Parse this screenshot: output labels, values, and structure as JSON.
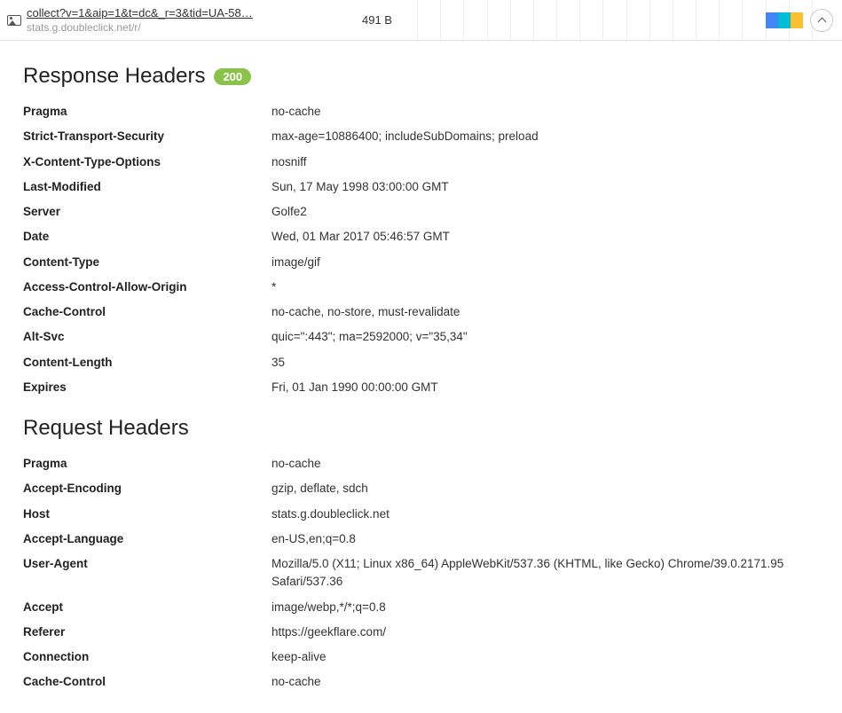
{
  "request_row": {
    "url_main": "collect?v=1&aip=1&t=dc&_r=3&tid=UA-58…",
    "url_sub": "stats.g.doubleclick.net/r/",
    "size": "491 B"
  },
  "swatch_colors": [
    "#4285f4",
    "#00bcd4",
    "#fbc02d"
  ],
  "response_section_title": "Response Headers",
  "status_badge": "200",
  "response_headers": [
    {
      "name": "Pragma",
      "value": "no-cache"
    },
    {
      "name": "Strict-Transport-Security",
      "value": "max-age=10886400; includeSubDomains; preload"
    },
    {
      "name": "X-Content-Type-Options",
      "value": "nosniff"
    },
    {
      "name": "Last-Modified",
      "value": "Sun, 17 May 1998 03:00:00 GMT"
    },
    {
      "name": "Server",
      "value": "Golfe2"
    },
    {
      "name": "Date",
      "value": "Wed, 01 Mar 2017 05:46:57 GMT"
    },
    {
      "name": "Content-Type",
      "value": "image/gif"
    },
    {
      "name": "Access-Control-Allow-Origin",
      "value": "*"
    },
    {
      "name": "Cache-Control",
      "value": "no-cache, no-store, must-revalidate"
    },
    {
      "name": "Alt-Svc",
      "value": "quic=\":443\"; ma=2592000; v=\"35,34\""
    },
    {
      "name": "Content-Length",
      "value": "35"
    },
    {
      "name": "Expires",
      "value": "Fri, 01 Jan 1990 00:00:00 GMT"
    }
  ],
  "request_section_title": "Request Headers",
  "request_headers": [
    {
      "name": "Pragma",
      "value": "no-cache"
    },
    {
      "name": "Accept-Encoding",
      "value": "gzip, deflate, sdch"
    },
    {
      "name": "Host",
      "value": "stats.g.doubleclick.net"
    },
    {
      "name": "Accept-Language",
      "value": "en-US,en;q=0.8"
    },
    {
      "name": "User-Agent",
      "value": "Mozilla/5.0 (X11; Linux x86_64) AppleWebKit/537.36 (KHTML, like Gecko) Chrome/39.0.2171.95 Safari/537.36"
    },
    {
      "name": "Accept",
      "value": "image/webp,*/*;q=0.8"
    },
    {
      "name": "Referer",
      "value": "https://geekflare.com/"
    },
    {
      "name": "Connection",
      "value": "keep-alive"
    },
    {
      "name": "Cache-Control",
      "value": "no-cache"
    }
  ]
}
